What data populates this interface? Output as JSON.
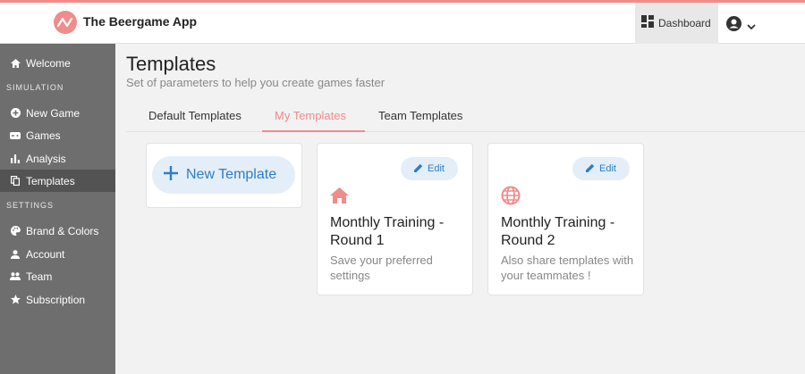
{
  "header": {
    "app_title": "The Beergame App",
    "dashboard_label": "Dashboard",
    "brand_color": "#f08c8a"
  },
  "sidebar": {
    "items": [
      {
        "label": "Welcome",
        "icon": "home-icon"
      },
      {
        "label": "New Game",
        "icon": "plus-circle-icon"
      },
      {
        "label": "Games",
        "icon": "gamepad-icon"
      },
      {
        "label": "Analysis",
        "icon": "bar-chart-icon"
      },
      {
        "label": "Templates",
        "icon": "copy-icon",
        "active": true
      },
      {
        "label": "Brand & Colors",
        "icon": "palette-icon"
      },
      {
        "label": "Account",
        "icon": "person-icon"
      },
      {
        "label": "Team",
        "icon": "group-icon"
      },
      {
        "label": "Subscription",
        "icon": "star-icon"
      }
    ],
    "sections": [
      "SIMULATION",
      "SETTINGS"
    ]
  },
  "main": {
    "title": "Templates",
    "subtitle": "Set of parameters to help you create games faster",
    "tabs": [
      {
        "label": "Default Templates"
      },
      {
        "label": "My Templates",
        "active": true
      },
      {
        "label": "Team Templates"
      }
    ],
    "new_template_label": "New Template",
    "cards": [
      {
        "title": "Monthly Training - Round 1",
        "description": "Save your preferred settings",
        "icon": "home-icon",
        "edit_label": "Edit"
      },
      {
        "title": "Monthly Training - Round 2",
        "description": "Also share templates with your teammates !",
        "icon": "globe-icon",
        "edit_label": "Edit"
      }
    ]
  }
}
